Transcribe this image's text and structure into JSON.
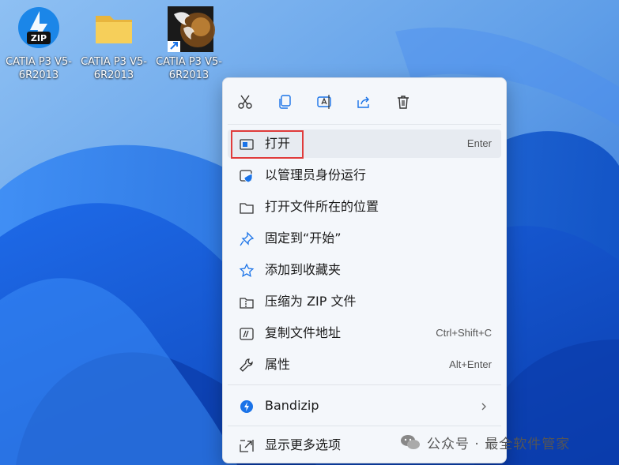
{
  "desktop": {
    "icons": [
      {
        "label": "CATIA P3 V5-6R2013",
        "type": "zip"
      },
      {
        "label": "CATIA P3 V5-6R2013",
        "type": "folder"
      },
      {
        "label": "CATIA P3 V5-6R2013",
        "type": "shortcut"
      }
    ],
    "zip_badge": "ZIP"
  },
  "context_menu": {
    "toolbar": [
      "scissors-icon",
      "copy-icon",
      "rename-icon",
      "share-icon",
      "trash-icon"
    ],
    "items": [
      {
        "label": "打开",
        "shortcut": "Enter",
        "icon": "window-icon"
      },
      {
        "label": "以管理员身份运行",
        "shortcut": "",
        "icon": "shield-icon"
      },
      {
        "label": "打开文件所在的位置",
        "shortcut": "",
        "icon": "folder-icon"
      },
      {
        "label": "固定到“开始”",
        "shortcut": "",
        "icon": "pin-icon"
      },
      {
        "label": "添加到收藏夹",
        "shortcut": "",
        "icon": "star-icon"
      },
      {
        "label": "压缩为 ZIP 文件",
        "shortcut": "",
        "icon": "zip-folder-icon"
      },
      {
        "label": "复制文件地址",
        "shortcut": "Ctrl+Shift+C",
        "icon": "path-icon"
      },
      {
        "label": "属性",
        "shortcut": "Alt+Enter",
        "icon": "wrench-icon"
      },
      {
        "label": "Bandizip",
        "shortcut": "",
        "icon": "bandizip-icon"
      },
      {
        "label": "显示更多选项",
        "shortcut": "",
        "icon": "expand-icon"
      }
    ]
  },
  "watermark": {
    "text": "公众号 · 最全软件管家"
  },
  "colors": {
    "highlight_border": "#e03b3b",
    "accent": "#1a73e8",
    "menu_bg": "#f4f7fb"
  }
}
